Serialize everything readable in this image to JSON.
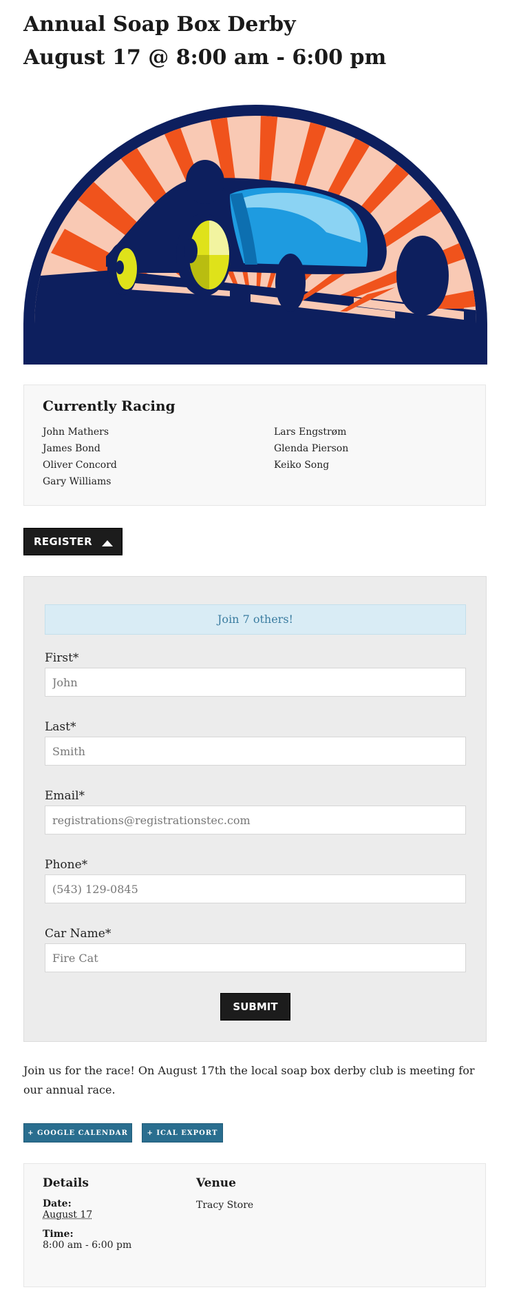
{
  "event": {
    "title_line1": "Annual Soap Box Derby",
    "title_line2": "August 17 @ 8:00 am - 6:00 pm"
  },
  "hero": {
    "icon": "soap-box-derby-car-illustration"
  },
  "currently_racing": {
    "heading": "Currently Racing",
    "column1": [
      "John Mathers",
      "James Bond",
      "Oliver Concord",
      "Gary Williams"
    ],
    "column2": [
      "Lars Engstrøm",
      "Glenda Pierson",
      "Keiko Song"
    ]
  },
  "register_button": {
    "label": "REGISTER",
    "icon": "caret-up-icon"
  },
  "form": {
    "notice": "Join 7 others!",
    "first": {
      "label": "First*",
      "placeholder": "John"
    },
    "last": {
      "label": "Last*",
      "placeholder": "Smith"
    },
    "email": {
      "label": "Email*",
      "placeholder": "registrations@registrationstec.com"
    },
    "phone": {
      "label": "Phone*",
      "placeholder": "(543) 129-0845"
    },
    "car_name": {
      "label": "Car Name*",
      "placeholder": "Fire Cat"
    },
    "submit_label": "SUBMIT"
  },
  "description": "Join us for the race! On August 17th the local soap box derby club is meeting for our annual race.",
  "calendar_links": {
    "google": "+ GOOGLE CALENDAR",
    "ical": "+ ICAL EXPORT"
  },
  "details": {
    "heading": "Details",
    "date_label": "Date:",
    "date_value": "August 17",
    "time_label": "Time:",
    "time_value": "8:00 am - 6:00 pm"
  },
  "venue": {
    "heading": "Venue",
    "name": "Tracy Store"
  },
  "colors": {
    "dark_navy": "#0d1f5e",
    "sun_orange": "#f0531c",
    "sun_peach": "#f9c9b4",
    "car_blue": "#1e9be0",
    "wheel_yellow": "#dfe21a",
    "notice_bg": "#d9ecf5",
    "calendar_button": "#2a6e8f"
  }
}
